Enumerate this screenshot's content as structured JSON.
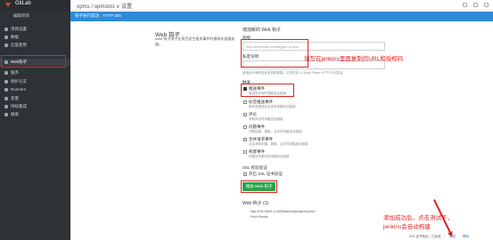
{
  "app": {
    "brand": "GitLab"
  },
  "topbar": {
    "breadcrumb": "opms / opmsbst ∨ 设置"
  },
  "sidebar": {
    "subtitle": "编辑项目",
    "items": [
      {
        "label": "项目设置"
      },
      {
        "label": "数据"
      },
      {
        "label": "信誉使用"
      },
      {
        "label": "Web钩子"
      },
      {
        "label": "服务"
      },
      {
        "label": "保护分支"
      },
      {
        "label": "Runners"
      },
      {
        "label": "变量"
      },
      {
        "label": "持续集成"
      },
      {
        "label": "徽章"
      }
    ]
  },
  "flash": {
    "text": "钩子执行成功：HTTP 200"
  },
  "left": {
    "title": "Web 钩子",
    "desc_link": "Web",
    "desc": " 钩子用于在项目发生相关事件时通知外部服务器。"
  },
  "form": {
    "section_title": "增加新的 Web 钩子",
    "url_label": "链接",
    "url_placeholder": "http://example.com/trigger-ci.json",
    "token_label": "私密令牌",
    "token_hint": "使用此令牌来验证收到的数据。它将在该 X-Gitlab-Token HTTP 头中发送。",
    "trigger_label": "触发",
    "events": [
      {
        "name": "推送事件",
        "desc": "推送至仓库时将触发此链接",
        "checked": true
      },
      {
        "name": "标签推送事件",
        "desc": "新标签推送至仓库时将触发此链接",
        "checked": false
      },
      {
        "name": "评论",
        "desc": "有新评论时将触发此链接",
        "checked": false
      },
      {
        "name": "问题事件",
        "desc": "问题创建、更新、合并时将触发此链接",
        "checked": false
      },
      {
        "name": "合并请求事件",
        "desc": "合并请求创建、更新、合并时将触发此链接",
        "checked": false
      },
      {
        "name": "构建事件",
        "desc": "构建状态更改时将触发此链接",
        "checked": false
      }
    ],
    "ssl_label": "SSL 校验验证",
    "ssl_check": "开启 SSL 证书验证",
    "add_button": "增加 Web 钩子"
  },
  "hooks": {
    "title": "Web 钩子 (1)",
    "url": "http://192.168.5.11:8083/jenkins/project/opms2",
    "events": "Push Events",
    "actions": [
      "SSL 证书验证：已启用",
      "测试",
      "移除"
    ]
  },
  "annotations": {
    "fill_hint": "填写在jenkins里面复制的URL和授权码",
    "after_hint": [
      "添加成功后，点击测试下，",
      "jenkins会自动构建"
    ]
  },
  "colors": {
    "sidebar_bg": "#2e3136",
    "flash_bg": "#2e8bd8",
    "add_button_bg": "#2da14c",
    "annotation": "#e02020"
  }
}
